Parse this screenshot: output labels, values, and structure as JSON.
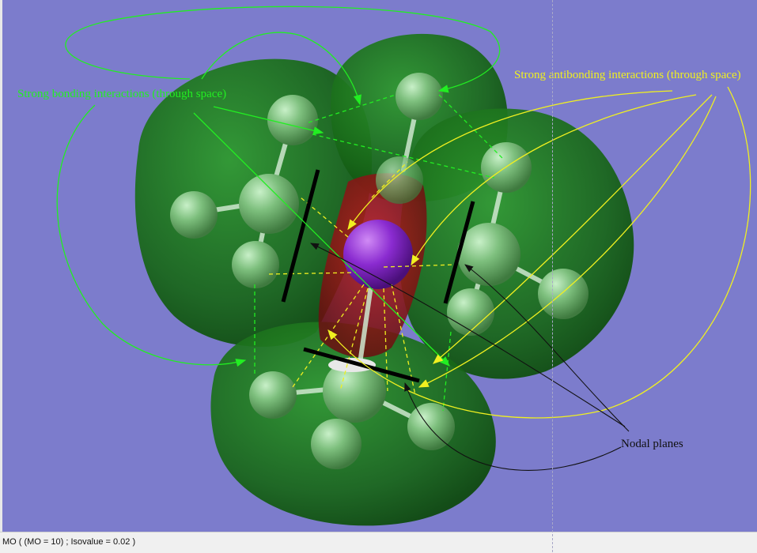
{
  "viewer": {
    "background": "#7c7ccc",
    "status_text": "MO ( (MO = 10) ; Isovalue = 0.02 )"
  },
  "annotations": {
    "bonding": {
      "text": "Strong bonding interactions (through space)",
      "color": "#22ee22"
    },
    "antibonding": {
      "text": "Strong antibonding interactions (through space)",
      "color": "#f0f020"
    },
    "nodal": {
      "text": "Nodal planes",
      "color": "#111111"
    }
  },
  "colors": {
    "lobe_positive": "#1f7a1f",
    "lobe_negative": "#a01818",
    "central_atom": "#8a2bd0",
    "hydrogen_like": "#7fc07f",
    "nodal_plane": "#000000"
  }
}
